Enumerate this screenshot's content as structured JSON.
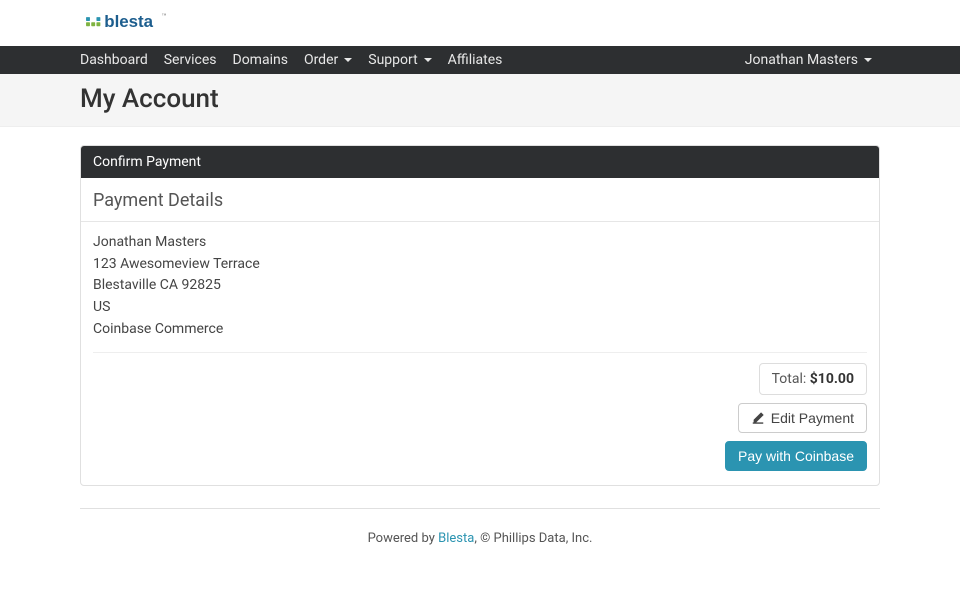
{
  "brand": {
    "name": "blesta"
  },
  "nav": {
    "items": [
      {
        "label": "Dashboard",
        "has_dropdown": false
      },
      {
        "label": "Services",
        "has_dropdown": false
      },
      {
        "label": "Domains",
        "has_dropdown": false
      },
      {
        "label": "Order",
        "has_dropdown": true
      },
      {
        "label": "Support",
        "has_dropdown": true
      },
      {
        "label": "Affiliates",
        "has_dropdown": false
      }
    ],
    "user_label": "Jonathan Masters"
  },
  "page": {
    "title": "My Account"
  },
  "panel": {
    "header": "Confirm Payment",
    "section_title": "Payment Details",
    "address": {
      "name": "Jonathan Masters",
      "street": "123 Awesomeview Terrace",
      "city_line": "Blestaville CA 92825",
      "country": "US",
      "method": "Coinbase Commerce"
    },
    "total_label": "Total:",
    "total_amount": "$10.00",
    "edit_label": "Edit Payment",
    "pay_label": "Pay with Coinbase"
  },
  "footer": {
    "prefix": "Powered by ",
    "link": "Blesta",
    "suffix": ", © Phillips Data, Inc."
  }
}
